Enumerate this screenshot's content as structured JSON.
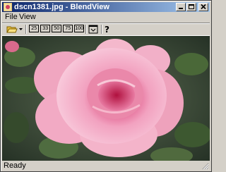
{
  "window": {
    "title": "dscn1381.jpg - BlendView"
  },
  "menu": {
    "file": "File",
    "view": "View"
  },
  "toolbar": {
    "zoom_levels": [
      "25",
      "33",
      "50",
      "75",
      "100"
    ]
  },
  "status": {
    "text": "Ready"
  },
  "colors": {
    "title_start": "#0a246a",
    "title_end": "#a6caf0",
    "face": "#d4d0c8"
  }
}
